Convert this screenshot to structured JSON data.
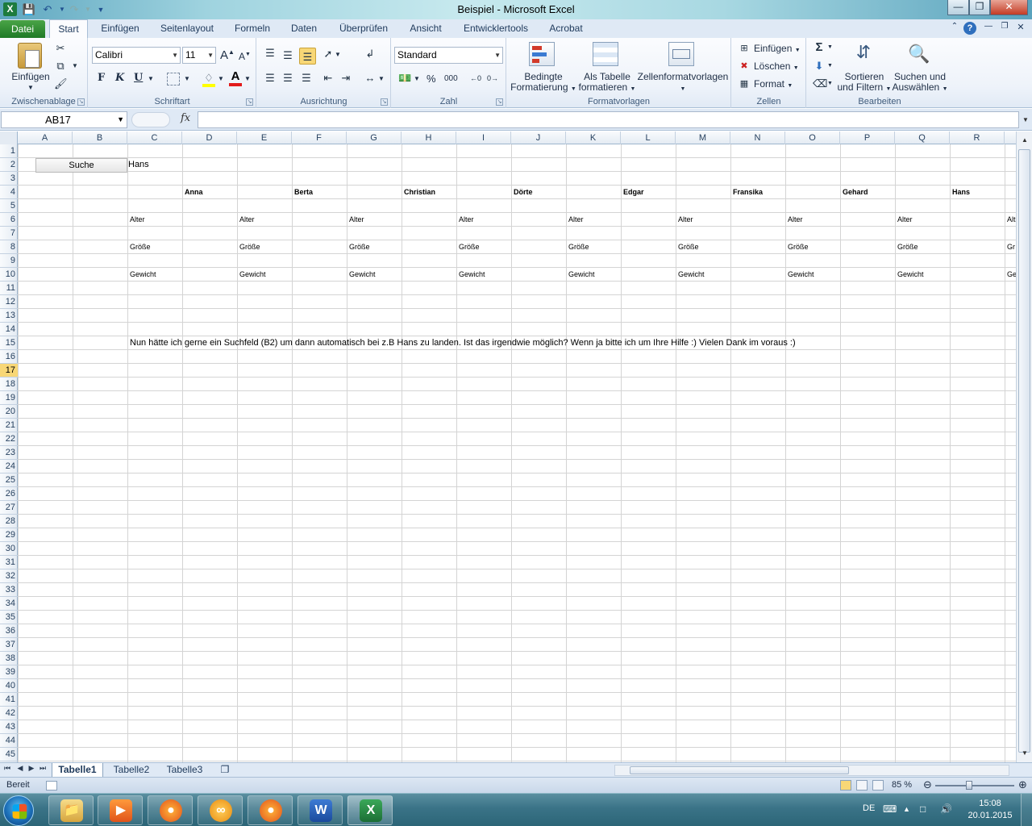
{
  "window": {
    "title": "Beispiel  -  Microsoft Excel",
    "app_icon_letter": "X"
  },
  "ribbon_tabs": [
    "Datei",
    "Start",
    "Einfügen",
    "Seitenlayout",
    "Formeln",
    "Daten",
    "Überprüfen",
    "Ansicht",
    "Entwicklertools",
    "Acrobat"
  ],
  "ribbon": {
    "clipboard": {
      "paste": "Einfügen",
      "label": "Zwischenablage"
    },
    "font": {
      "name": "Calibri",
      "size": "11",
      "bold": "F",
      "italic": "K",
      "underline": "U",
      "label": "Schriftart"
    },
    "alignment": {
      "label": "Ausrichtung"
    },
    "number": {
      "format": "Standard",
      "percent": "%",
      "thousands": "000",
      "label": "Zahl"
    },
    "styles": {
      "conditional_line1": "Bedingte",
      "conditional_line2": "Formatierung",
      "as_table_line1": "Als Tabelle",
      "as_table_line2": "formatieren",
      "cell_styles": "Zellenformatvorlagen",
      "label": "Formatvorlagen"
    },
    "cells": {
      "insert": "Einfügen",
      "delete": "Löschen",
      "format": "Format",
      "label": "Zellen"
    },
    "editing": {
      "sort_line1": "Sortieren",
      "sort_line2": "und Filtern",
      "find_line1": "Suchen und",
      "find_line2": "Auswählen",
      "label": "Bearbeiten"
    }
  },
  "formula_bar": {
    "name_box": "AB17",
    "fx": "fx",
    "value": ""
  },
  "columns": [
    "A",
    "B",
    "C",
    "D",
    "E",
    "F",
    "G",
    "H",
    "I",
    "J",
    "K",
    "L",
    "M",
    "N",
    "O",
    "P",
    "Q",
    "R"
  ],
  "rows": [
    "1",
    "2",
    "3",
    "4",
    "5",
    "6",
    "7",
    "8",
    "9",
    "10",
    "11",
    "12",
    "13",
    "14",
    "15",
    "16",
    "17",
    "18",
    "19",
    "20",
    "21",
    "22",
    "23",
    "24",
    "25",
    "26",
    "27",
    "28",
    "29",
    "30",
    "31",
    "32",
    "33",
    "34",
    "35",
    "36",
    "37",
    "38",
    "39",
    "40",
    "41",
    "42",
    "43",
    "44",
    "45"
  ],
  "active_row": "17",
  "sheet": {
    "search_button": "Suche",
    "search_value": "Hans",
    "names": [
      "Anna",
      "Berta",
      "Christian",
      "Dörte",
      "Edgar",
      "Fransika",
      "Gehard",
      "Hans"
    ],
    "label_age": "Alter",
    "label_height": "Größe",
    "label_weight": "Gewicht",
    "label_age_cut": "Alt",
    "label_height_cut": "Gr",
    "label_weight_cut": "Ge",
    "note": "Nun hätte ich gerne ein Suchfeld (B2) um dann automatisch bei z.B Hans zu landen. Ist das irgendwie möglich? Wenn ja bitte ich um Ihre Hilfe :) Vielen Dank im voraus :)"
  },
  "sheet_tabs": [
    "Tabelle1",
    "Tabelle2",
    "Tabelle3"
  ],
  "status": {
    "ready": "Bereit",
    "zoom": "85 %"
  },
  "taskbar": {
    "language": "DE",
    "time": "15:08",
    "date": "20.01.2015"
  }
}
